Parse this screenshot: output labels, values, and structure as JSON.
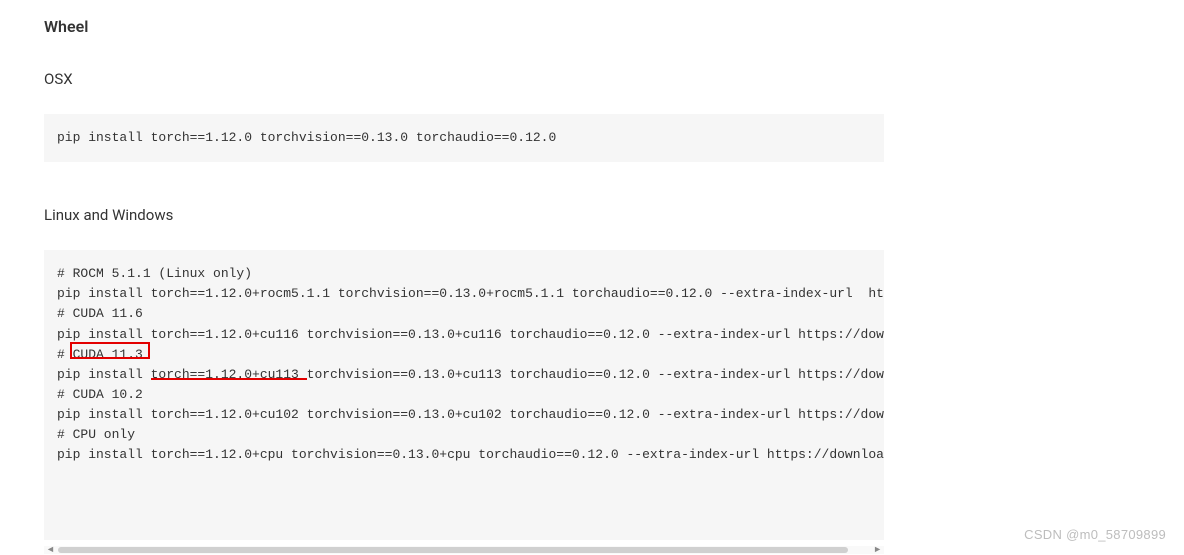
{
  "section": {
    "heading_wheel": "Wheel",
    "heading_osx": "OSX",
    "heading_linux_windows": "Linux and Windows"
  },
  "code_osx": "pip install torch==1.12.0 torchvision==0.13.0 torchaudio==0.12.0",
  "code_linux": {
    "line1": "# ROCM 5.1.1 (Linux only)",
    "line2": "pip install torch==1.12.0+rocm5.1.1 torchvision==0.13.0+rocm5.1.1 torchaudio==0.12.0 --extra-index-url  https",
    "line3": "# CUDA 11.6",
    "line4": "pip install torch==1.12.0+cu116 torchvision==0.13.0+cu116 torchaudio==0.12.0 --extra-index-url https://downl",
    "line5": "# CUDA 11.3",
    "line6": "pip install torch==1.12.0+cu113 torchvision==0.13.0+cu113 torchaudio==0.12.0 --extra-index-url https://downl",
    "line7": "# CUDA 10.2",
    "line8": "pip install torch==1.12.0+cu102 torchvision==0.13.0+cu102 torchaudio==0.12.0 --extra-index-url https://downl",
    "line9": "# CPU only",
    "line10": "pip install torch==1.12.0+cpu torchvision==0.13.0+cpu torchaudio==0.12.0 --extra-index-url https://download."
  },
  "watermark": "CSDN @m0_58709899",
  "annotations": {
    "box_text": "CUDA 11.3",
    "underline_text": "torch==1.12.0+cu113"
  }
}
